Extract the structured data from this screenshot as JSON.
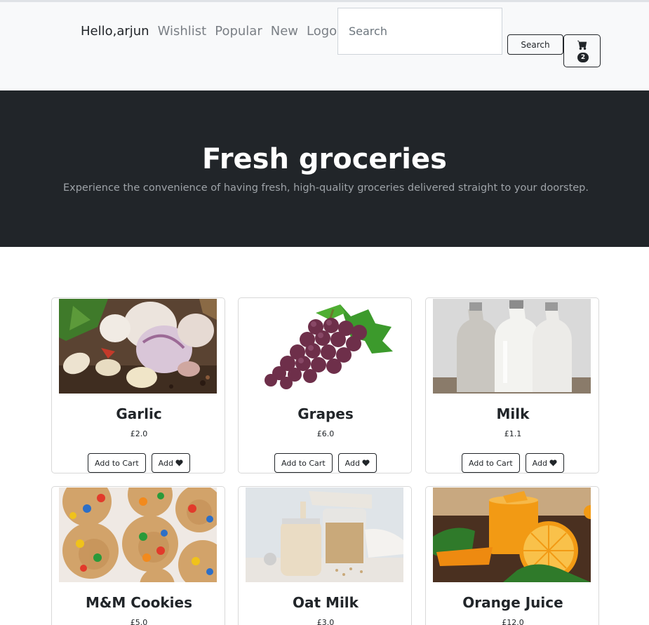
{
  "nav": {
    "greeting": "Hello,arjun",
    "links": [
      "Wishlist",
      "Popular",
      "New",
      "Logout"
    ],
    "search_placeholder": "Search",
    "search_value": "",
    "search_button": "Search",
    "cart_icon": "cart-icon",
    "cart_count": "2"
  },
  "hero": {
    "title": "Fresh groceries",
    "subtitle": "Experience the convenience of having fresh, high-quality groceries delivered straight to your doorstep."
  },
  "products": [
    {
      "name": "Garlic",
      "price": "£2.0",
      "image": "garlic-image",
      "add_to_cart": "Add to Cart",
      "wishlist": "Add"
    },
    {
      "name": "Grapes",
      "price": "£6.0",
      "image": "grapes-image",
      "add_to_cart": "Add to Cart",
      "wishlist": "Add"
    },
    {
      "name": "Milk",
      "price": "£1.1",
      "image": "milk-image",
      "add_to_cart": "Add to Cart",
      "wishlist": "Add"
    },
    {
      "name": "M&M Cookies",
      "price": "£5.0",
      "image": "cookies-image"
    },
    {
      "name": "Oat Milk",
      "price": "£3.0",
      "image": "oat-milk-image"
    },
    {
      "name": "Orange Juice",
      "price": "£12.0",
      "image": "orange-juice-image"
    }
  ],
  "colors": {
    "navbar_bg": "#f8f9fa",
    "hero_bg": "#212529",
    "text_dark": "#212529",
    "nav_link": "#7a7f85"
  }
}
